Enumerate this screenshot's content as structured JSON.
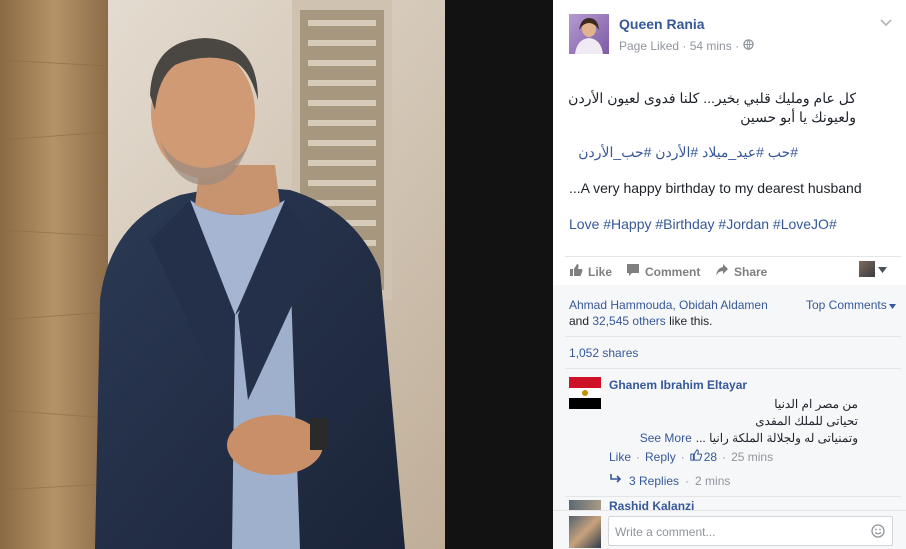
{
  "post": {
    "author": "Queen Rania",
    "meta": "Page Liked · 54 mins ·",
    "arabic_line1": "كل عام ومليك قلبي بخير... كلنا فدوى لعيون الأردن",
    "arabic_line2": "ولعيونك يا أبو حسين",
    "arabic_hashtags": "#حب #عيد_ميلاد #الأردن #حب_الأردن",
    "english_text": "...A very happy birthday to my dearest husband",
    "english_hashtags": "Love #Happy #Birthday #Jordan #LoveJO#"
  },
  "actions": {
    "like": "Like",
    "comment": "Comment",
    "share": "Share"
  },
  "stats": {
    "likers": "Ahmad Hammouda, Obidah Aldamen",
    "and": "and",
    "others": "32,545 others",
    "like_this": "like this.",
    "top_comments": "Top Comments",
    "shares": "1,052 shares"
  },
  "comments": [
    {
      "author": "Ghanem Ibrahim Eltayar",
      "line1": "من مصر ام الدنيا",
      "line2": "تحياتى للملك المفدى",
      "line3": "وتمنياتى له ولجلالة الملكة رانيا ...",
      "see_more": "See More",
      "like": "Like",
      "reply": "Reply",
      "likes": "28",
      "time": "25 mins",
      "replies": "3 Replies",
      "replies_time": "2 mins"
    },
    {
      "author": "Rashid Kalanzi"
    }
  ],
  "composer": {
    "placeholder": "Write a comment..."
  },
  "icons": [
    "chevron-down-icon",
    "globe-icon",
    "like-icon",
    "comment-icon",
    "share-icon",
    "reply-arrow-icon",
    "emoji-icon",
    "egypt-flag-icon"
  ]
}
